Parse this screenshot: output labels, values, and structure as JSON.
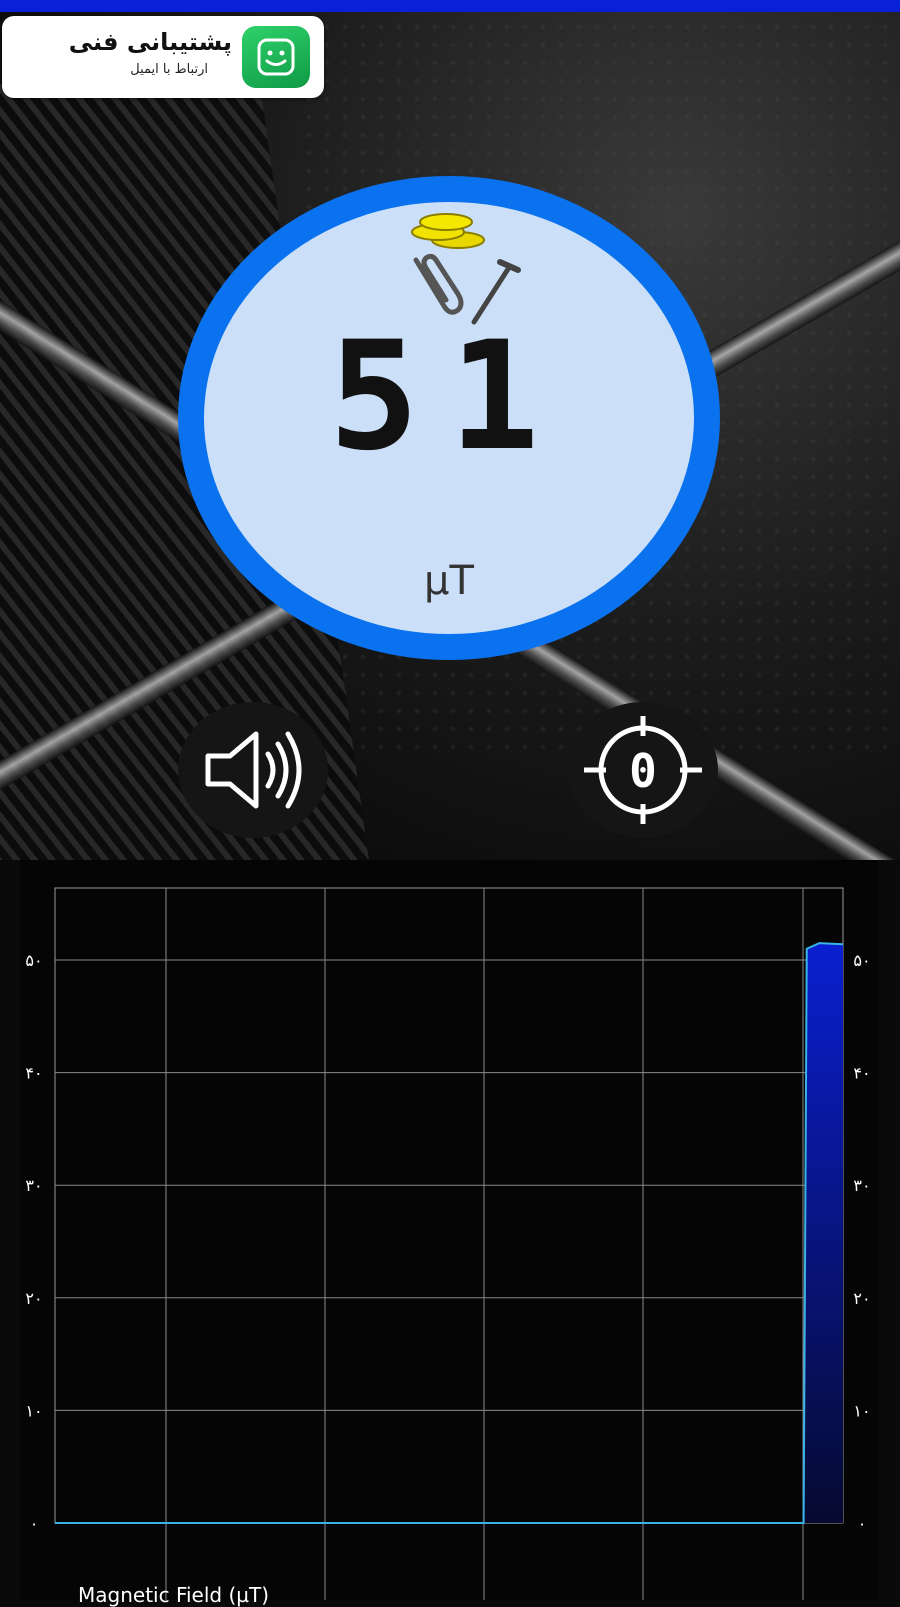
{
  "support": {
    "title": "پشتیبانی فنی",
    "subtitle": "ارتباط با ایمیل"
  },
  "gauge": {
    "reading": "51",
    "unit": "µT",
    "icon": "metals-icon"
  },
  "controls": {
    "sound_icon": "speaker-icon",
    "calibrate_icon": "target-zero-icon",
    "calibrate_glyph": "0"
  },
  "colors": {
    "status_bar": "#0a1fd8",
    "accent": "#0a72ef",
    "gauge_face": "#ccdff8",
    "series_fill": "#0a1fd0",
    "series_line": "#39b4e6"
  },
  "chart_data": {
    "type": "area",
    "title": "Magnetic Field (µT)",
    "ylim": [
      0,
      60
    ],
    "ytick_labels": [
      "۰",
      "۱۰",
      "۲۰",
      "۳۰",
      "۴۰",
      "۵۰"
    ],
    "ytick_values": [
      0,
      10,
      20,
      30,
      40,
      50
    ],
    "x": [
      0,
      1,
      2,
      3,
      4,
      4.75,
      4.77,
      4.85,
      5
    ],
    "values": [
      0,
      0,
      0,
      0,
      0,
      0,
      51,
      51.5,
      51.4
    ],
    "grid": true
  }
}
